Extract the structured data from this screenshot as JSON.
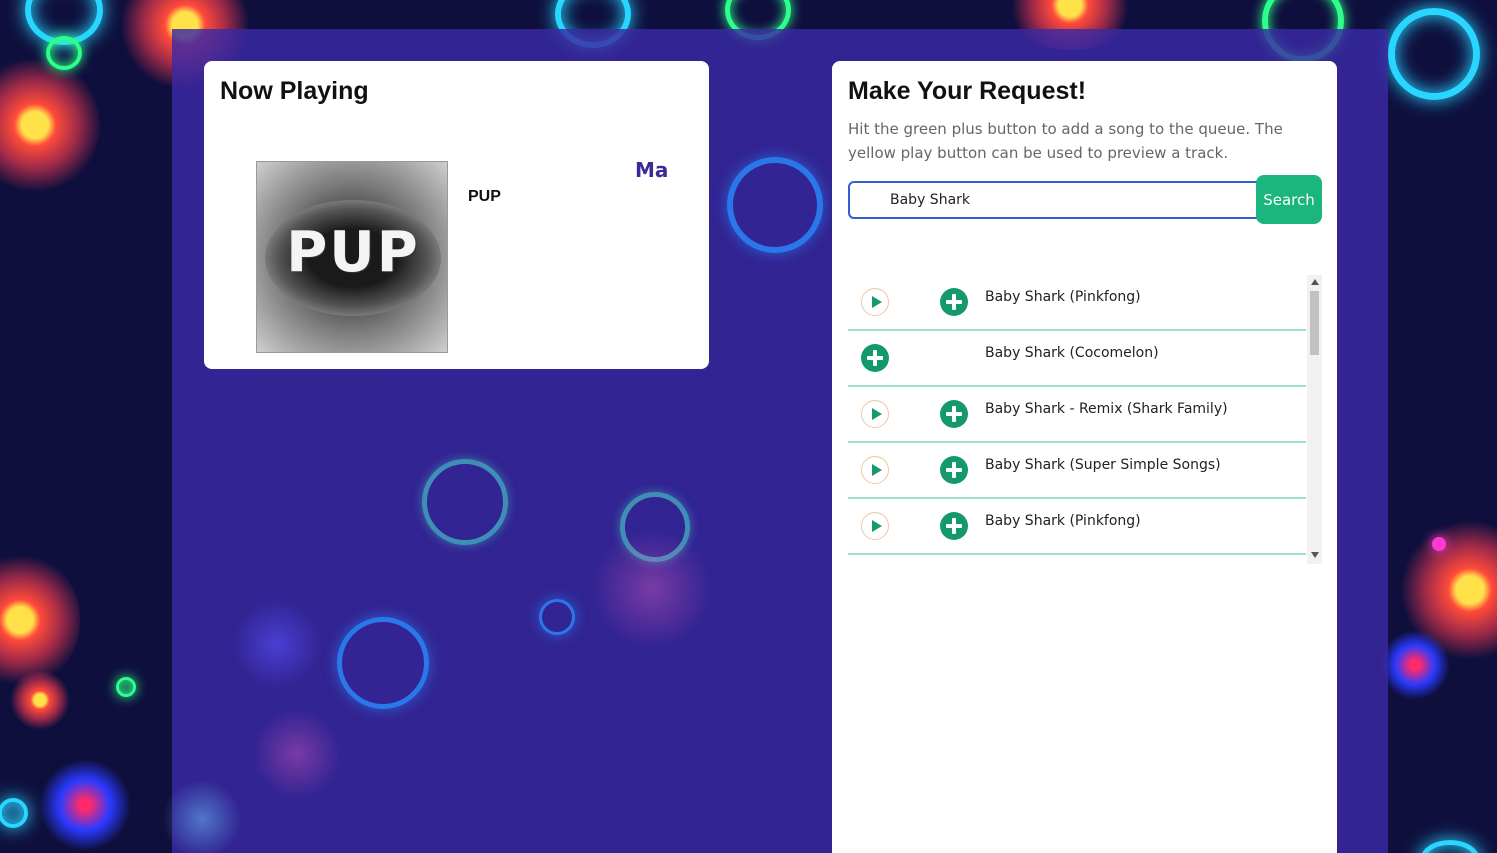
{
  "now_playing": {
    "title": "Now Playing",
    "artist": "PUP",
    "album_art_text": "PUP",
    "marquee_text": "Ma"
  },
  "request": {
    "title": "Make Your Request!",
    "description": "Hit the green plus button to add a song to the queue. The yellow play button can be used to preview a track.",
    "search_value": "Baby Shark",
    "search_button": "Search"
  },
  "results": [
    {
      "label": "Baby Shark (Pinkfong)",
      "has_preview": true
    },
    {
      "label": "Baby Shark (Cocomelon)",
      "has_preview": false
    },
    {
      "label": "Baby Shark - Remix (Shark Family)",
      "has_preview": true
    },
    {
      "label": "Baby Shark (Super Simple Songs)",
      "has_preview": true
    },
    {
      "label": "Baby Shark (Pinkfong)",
      "has_preview": true
    }
  ],
  "icons": {
    "play": "play-icon",
    "add": "plus-circle-icon"
  },
  "colors": {
    "accent_green": "#1bb57e",
    "add_button": "#149a6a",
    "background": "#3a2aa5",
    "row_divider": "#9fe0d0"
  }
}
